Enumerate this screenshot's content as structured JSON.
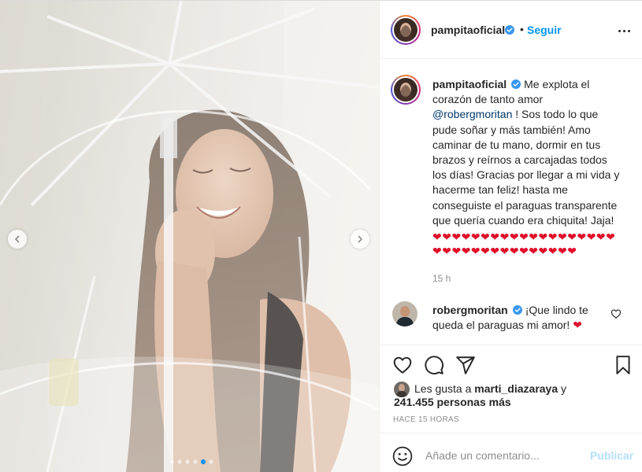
{
  "post": {
    "author": "pampitaoficial",
    "follow_label": "Seguir",
    "separator": "•",
    "caption_text": "Me explota el corazón de tanto amor",
    "caption_mention": "@robergmoritan",
    "caption_rest": "! Sos todo lo que pude soñar y más también! Amo caminar de tu mano, dormir en tus brazos y reírnos a carcajadas todos los días! Gracias por llegar a mi vida y hacerme tan feliz! hasta me conseguiste el paraguas transparente que quería cuando era chiquita! Jaja!",
    "caption_hearts": "❤❤❤❤❤❤❤❤❤❤❤❤❤❤❤❤❤❤❤❤❤❤❤❤❤❤❤❤❤❤❤❤❤❤",
    "caption_time": "15 h"
  },
  "comment": {
    "author": "robergmoritan",
    "text": "¡Que lindo te queda el paraguas mi amor!",
    "emoji": "❤"
  },
  "likes": {
    "prefix": "Les gusta a",
    "liker": "marti_diazaraya",
    "conjunction": "y",
    "count_text": "241.455 personas más"
  },
  "posted_ago": "HACE 15 HORAS",
  "comment_box": {
    "placeholder": "Añade un comentario...",
    "post_label": "Publicar"
  },
  "carousel": {
    "total": 6,
    "active_index": 4
  },
  "colors": {
    "link": "#0095f6",
    "mention": "#00376b",
    "heart": "#e0102a",
    "muted": "#8e8e8e",
    "post_disabled": "#b2dffc"
  },
  "icons": {
    "verified": "verified-badge-icon",
    "more": "more-options-icon",
    "like": "heart-outline-icon",
    "comment": "speech-bubble-icon",
    "share": "paper-plane-icon",
    "save": "bookmark-icon",
    "emoji": "smiley-icon",
    "prev": "chevron-left-icon",
    "next": "chevron-right-icon"
  }
}
